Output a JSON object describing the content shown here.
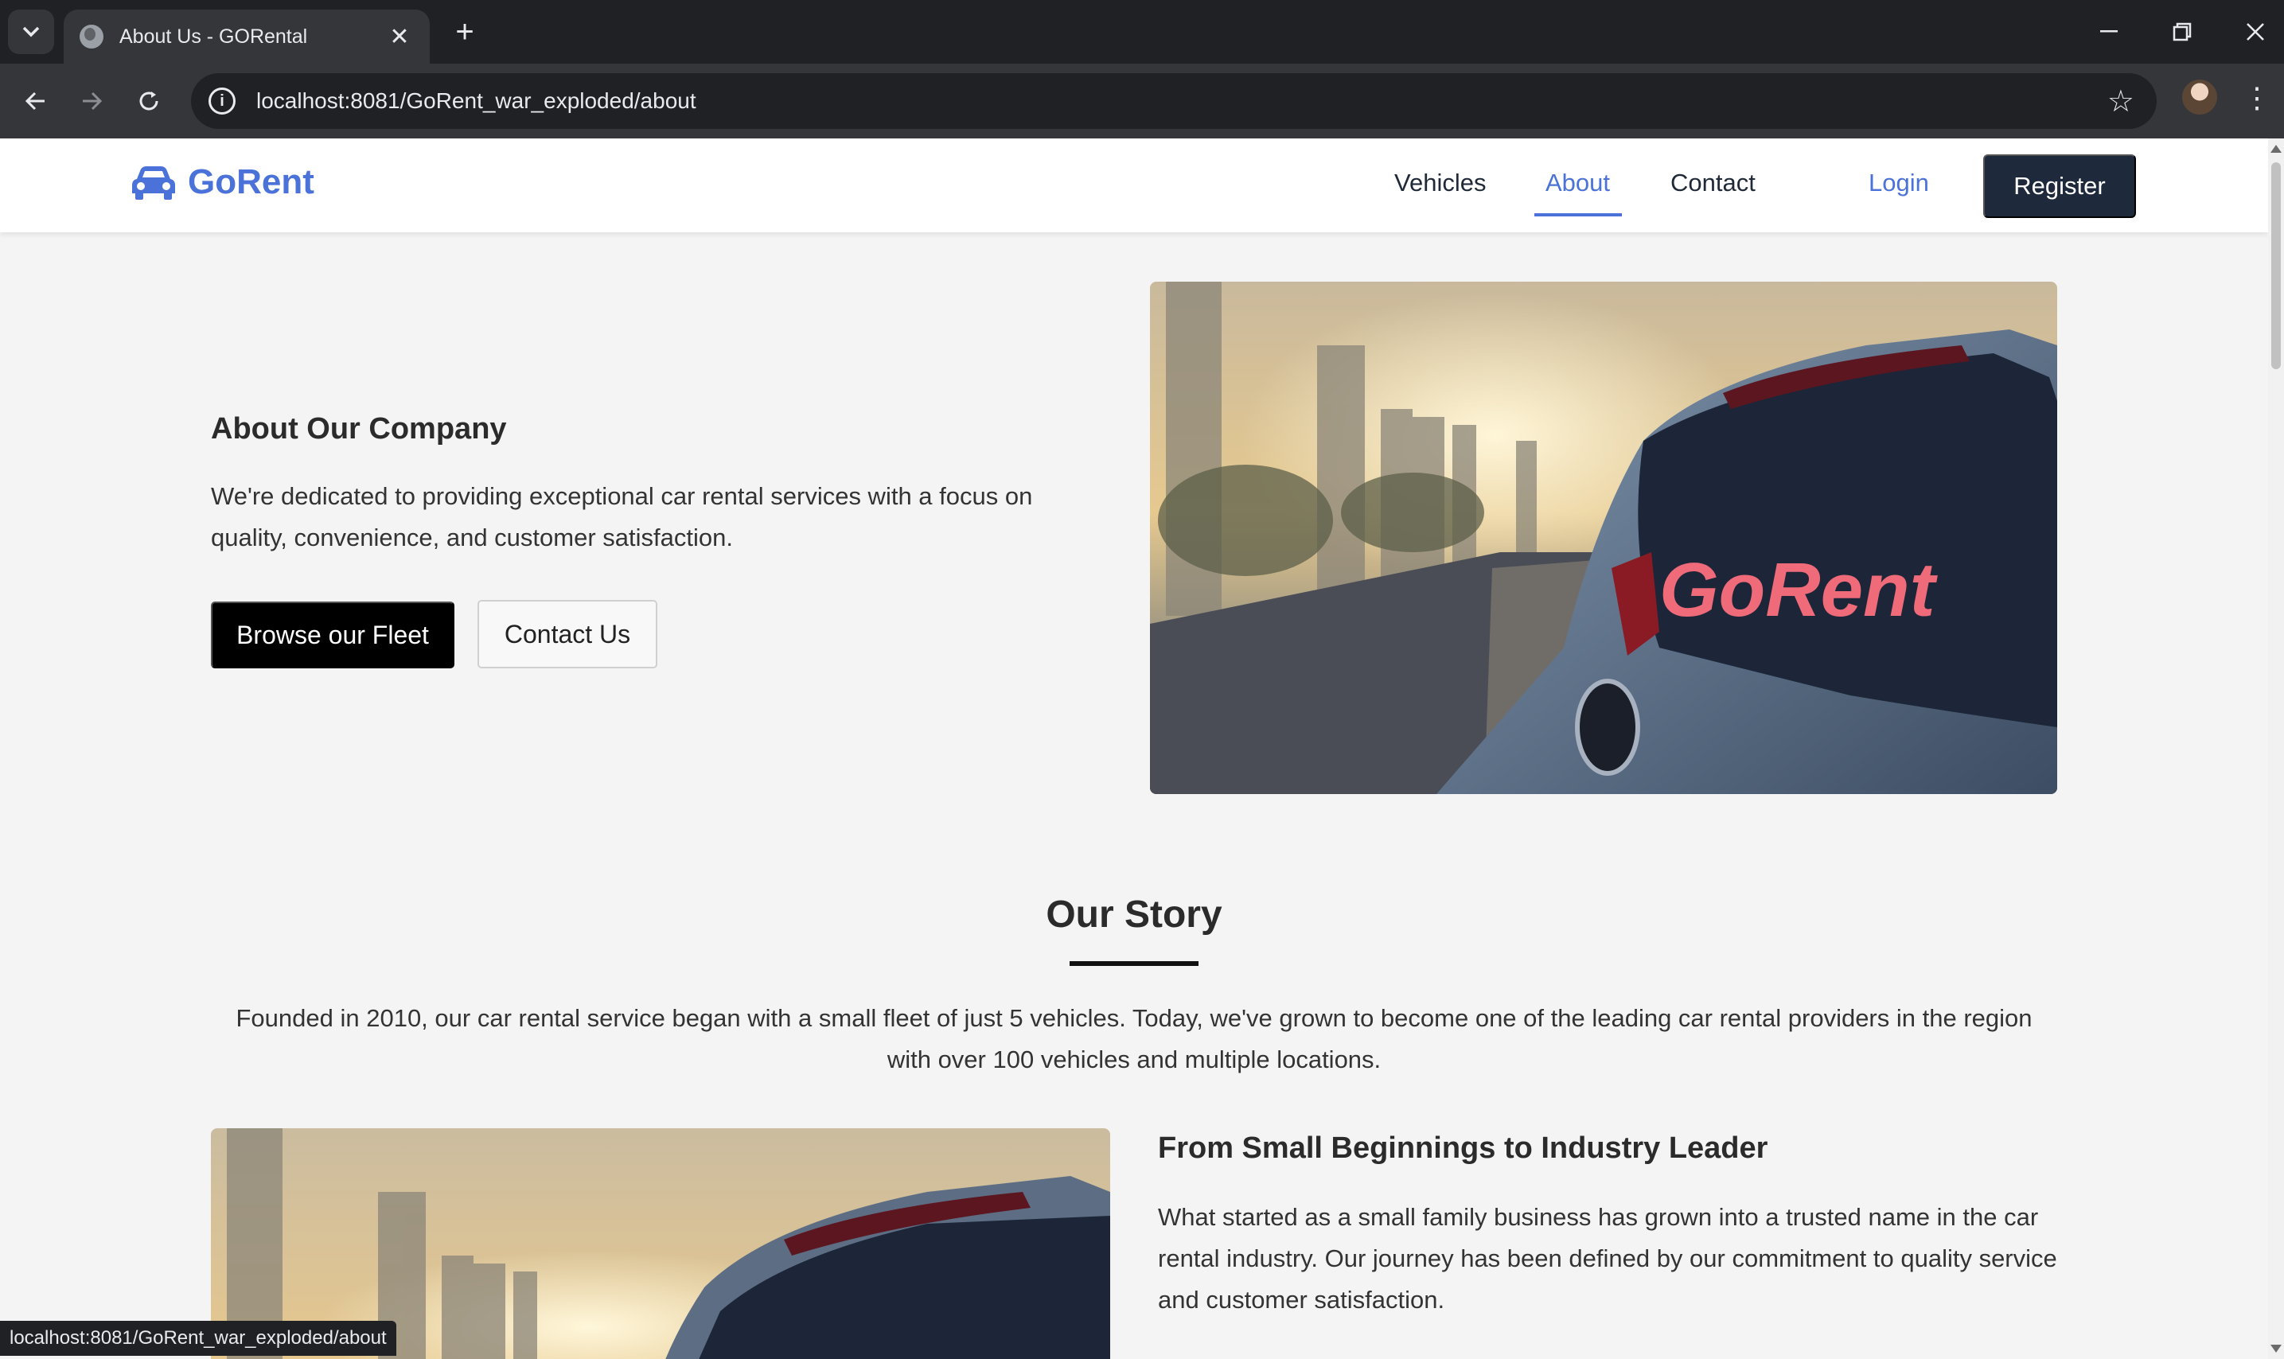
{
  "browser": {
    "tab_title": "About Us - GORental",
    "url": "localhost:8081/GoRent_war_exploded/about",
    "status_url": "localhost:8081/GoRent_war_exploded/about"
  },
  "header": {
    "brand": "GoRent",
    "nav": [
      {
        "label": "Vehicles"
      },
      {
        "label": "About",
        "active": true
      },
      {
        "label": "Contact"
      }
    ],
    "login_label": "Login",
    "register_label": "Register"
  },
  "hero": {
    "title": "About Our Company",
    "description": "We're dedicated to providing exceptional car rental services with a focus on quality, convenience, and customer satisfaction.",
    "primary_button": "Browse our Fleet",
    "secondary_button": "Contact Us",
    "image_logo_text": "GoRent"
  },
  "story": {
    "heading": "Our Story",
    "text": "Founded in 2010, our car rental service began with a small fleet of just 5 vehicles. Today, we've grown to become one of the leading car rental providers in the region with over 100 vehicles and multiple locations.",
    "subheading": "From Small Beginnings to Industry Leader",
    "subtext": "What started as a small family business has grown into a trusted name in the car rental industry. Our journey has been defined by our commitment to quality service and customer satisfaction."
  },
  "colors": {
    "brand": "#4a72d8",
    "register_bg": "#1e293b",
    "page_bg": "#f4f4f4"
  }
}
